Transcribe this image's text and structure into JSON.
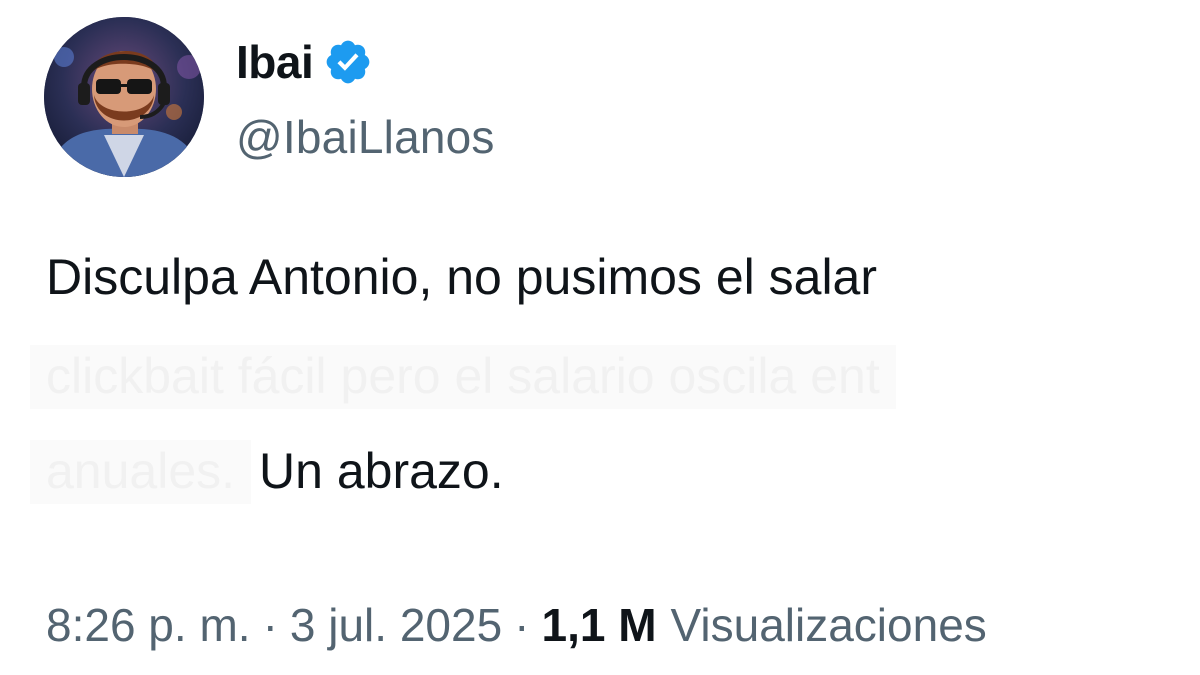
{
  "author": {
    "display_name": "Ibai",
    "handle": "@IbaiLlanos",
    "verified_icon": "verified-badge-icon",
    "verified_color": "#1d9bf0"
  },
  "tweet": {
    "line1": "Disculpa Antonio, no pusimos el salar",
    "line2_faded": "clickbait fácil pero el salario oscila ent",
    "line3_faded": "anuales.",
    "line3_clear": "Un abrazo."
  },
  "meta": {
    "time": "8:26 p. m.",
    "separator": "·",
    "date": "3 jul. 2025",
    "views_count": "1,1 M",
    "views_label": "Visualizaciones"
  },
  "colors": {
    "text_primary": "#0f1419",
    "text_secondary": "#536471"
  }
}
